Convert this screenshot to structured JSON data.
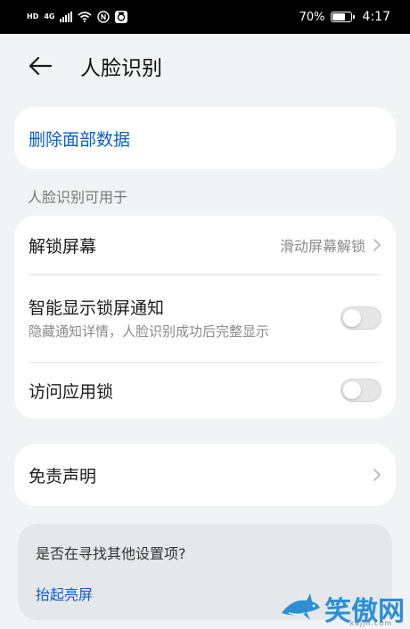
{
  "status_bar": {
    "hd": "HD",
    "network": "4G",
    "battery": "70%",
    "time": "4:17"
  },
  "header": {
    "title": "人脸识别"
  },
  "delete_card": {
    "label": "删除面部数据"
  },
  "section": {
    "label": "人脸识别可用于"
  },
  "settings": [
    {
      "title": "解锁屏幕",
      "value": "滑动屏幕解锁"
    },
    {
      "title": "智能显示锁屏通知",
      "subtitle": "隐藏通知详情，人脸识别成功后完整显示",
      "toggle": false
    },
    {
      "title": "访问应用锁",
      "toggle": false
    }
  ],
  "disclaimer": {
    "title": "免责声明"
  },
  "search_suggest": {
    "question": "是否在寻找其他设置项?",
    "link": "抬起亮屏"
  },
  "watermark": {
    "text": "笑傲网",
    "domain": "xajjn.com"
  },
  "colors": {
    "accent": "#0b5ecf",
    "background": "#f1f3f5"
  }
}
